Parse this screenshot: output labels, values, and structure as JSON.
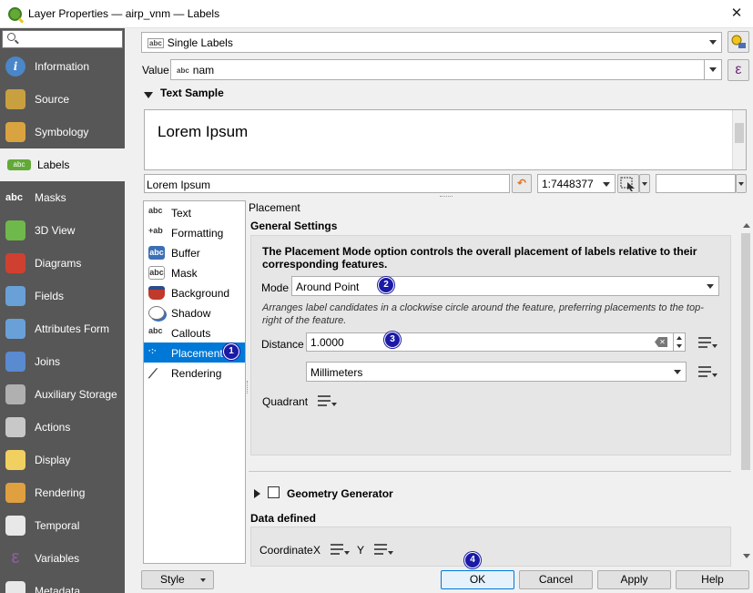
{
  "window": {
    "title": "Layer Properties — airp_vnm — Labels",
    "close": "✕"
  },
  "sidebar": {
    "search_placeholder": "",
    "items": [
      {
        "label": "Information",
        "icon": "info-icon",
        "color": "#4a86c8"
      },
      {
        "label": "Source",
        "icon": "wrench-icon",
        "color": "#c8a040"
      },
      {
        "label": "Symbology",
        "icon": "brush-icon",
        "color": "#d9a440"
      },
      {
        "label": "Labels",
        "icon": "labels-icon",
        "color": "#62a938"
      },
      {
        "label": "Masks",
        "icon": "mask-icon",
        "color": "#e8e8e8"
      },
      {
        "label": "3D View",
        "icon": "cube-icon",
        "color": "#6fb84a"
      },
      {
        "label": "Diagrams",
        "icon": "diagram-icon",
        "color": "#d04030"
      },
      {
        "label": "Fields",
        "icon": "fields-icon",
        "color": "#6aa0d8"
      },
      {
        "label": "Attributes Form",
        "icon": "form-icon",
        "color": "#6aa0d8"
      },
      {
        "label": "Joins",
        "icon": "joins-icon",
        "color": "#5a8ad0"
      },
      {
        "label": "Auxiliary Storage",
        "icon": "storage-icon",
        "color": "#b0b0b0"
      },
      {
        "label": "Actions",
        "icon": "gear-icon",
        "color": "#c8c8c8"
      },
      {
        "label": "Display",
        "icon": "display-icon",
        "color": "#f0d060"
      },
      {
        "label": "Rendering",
        "icon": "brush-icon",
        "color": "#e0a040"
      },
      {
        "label": "Temporal",
        "icon": "clock-icon",
        "color": "#e8e8e8"
      },
      {
        "label": "Variables",
        "icon": "epsilon-icon",
        "color": "#9060a0"
      },
      {
        "label": "Metadata",
        "icon": "metadata-icon",
        "color": "#e8e8e8"
      }
    ]
  },
  "top": {
    "mode_value": "Single Labels",
    "value_label": "Value",
    "value_field": "nam",
    "text_sample_heading": "Text Sample",
    "sample_text": "Lorem Ipsum",
    "sample_input": "Lorem Ipsum",
    "scale_value": "1:7448377"
  },
  "tabs": [
    {
      "label": "Text",
      "icon": "text-icon"
    },
    {
      "label": "Formatting",
      "icon": "formatting-icon"
    },
    {
      "label": "Buffer",
      "icon": "buffer-icon"
    },
    {
      "label": "Mask",
      "icon": "mask-icon"
    },
    {
      "label": "Background",
      "icon": "background-icon"
    },
    {
      "label": "Shadow",
      "icon": "shadow-icon"
    },
    {
      "label": "Callouts",
      "icon": "callouts-icon"
    },
    {
      "label": "Placement",
      "icon": "placement-icon"
    },
    {
      "label": "Rendering",
      "icon": "rendering-icon"
    }
  ],
  "placement": {
    "section_title": "Placement",
    "general_heading": "General Settings",
    "description": "The Placement Mode option controls the overall placement of labels relative to their corresponding features.",
    "mode_label": "Mode",
    "mode_value": "Around Point",
    "mode_help": "Arranges label candidates in a clockwise circle around the feature, preferring placements to the top-right of the feature.",
    "distance_label": "Distance",
    "distance_value": "1.0000",
    "unit_value": "Millimeters",
    "quadrant_label": "Quadrant",
    "geometry_generator": "Geometry Generator",
    "data_defined": "Data defined",
    "coordinate_label": "Coordinate",
    "x_label": "X",
    "y_label": "Y"
  },
  "markers": [
    "1",
    "2",
    "3",
    "4"
  ],
  "footer": {
    "style": "Style",
    "ok": "OK",
    "cancel": "Cancel",
    "apply": "Apply",
    "help": "Help"
  }
}
